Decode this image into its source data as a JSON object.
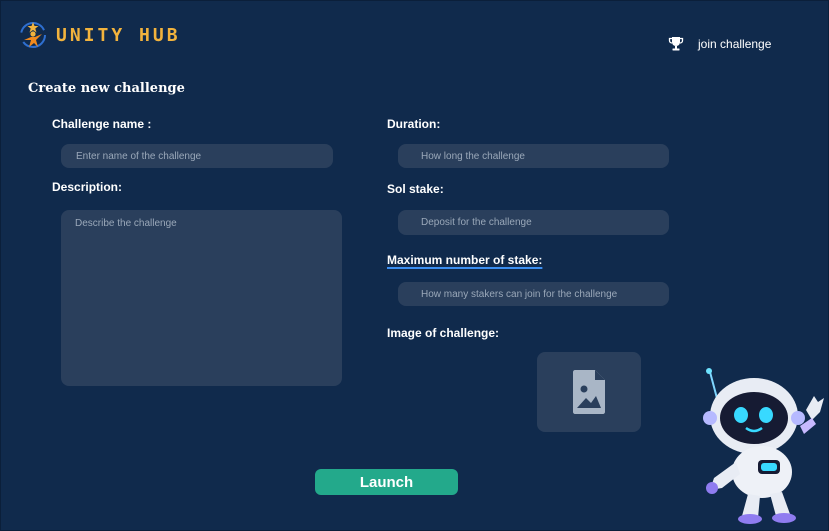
{
  "header": {
    "brand": "UNITY HUB",
    "join_label": "join challenge"
  },
  "page": {
    "title": "Create new challenge"
  },
  "form": {
    "challenge_name": {
      "label": "Challenge name :",
      "placeholder": "Enter name of the challenge",
      "value": ""
    },
    "description": {
      "label": "Description:",
      "placeholder": "Describe the challenge",
      "value": ""
    },
    "duration": {
      "label": "Duration:",
      "placeholder": "How long the challenge",
      "value": ""
    },
    "sol_stake": {
      "label": "Sol stake:",
      "placeholder": "Deposit for the challenge",
      "value": ""
    },
    "max_stake": {
      "label": "Maximum number of stake:",
      "placeholder": "How many stakers can join for the challenge",
      "value": ""
    },
    "image": {
      "label": "Image of challenge:",
      "icon": "image-file-icon"
    },
    "launch_label": "Launch"
  },
  "colors": {
    "background": "#102a4c",
    "field": "#2a3f5c",
    "brand": "#f2b33d",
    "button": "#23a98b",
    "spellcheck_underline": "#3b8ef0"
  },
  "icons": {
    "logo": "person-star-logo-icon",
    "join": "trophy-icon",
    "mascot": "robot-mascot-illustration"
  }
}
